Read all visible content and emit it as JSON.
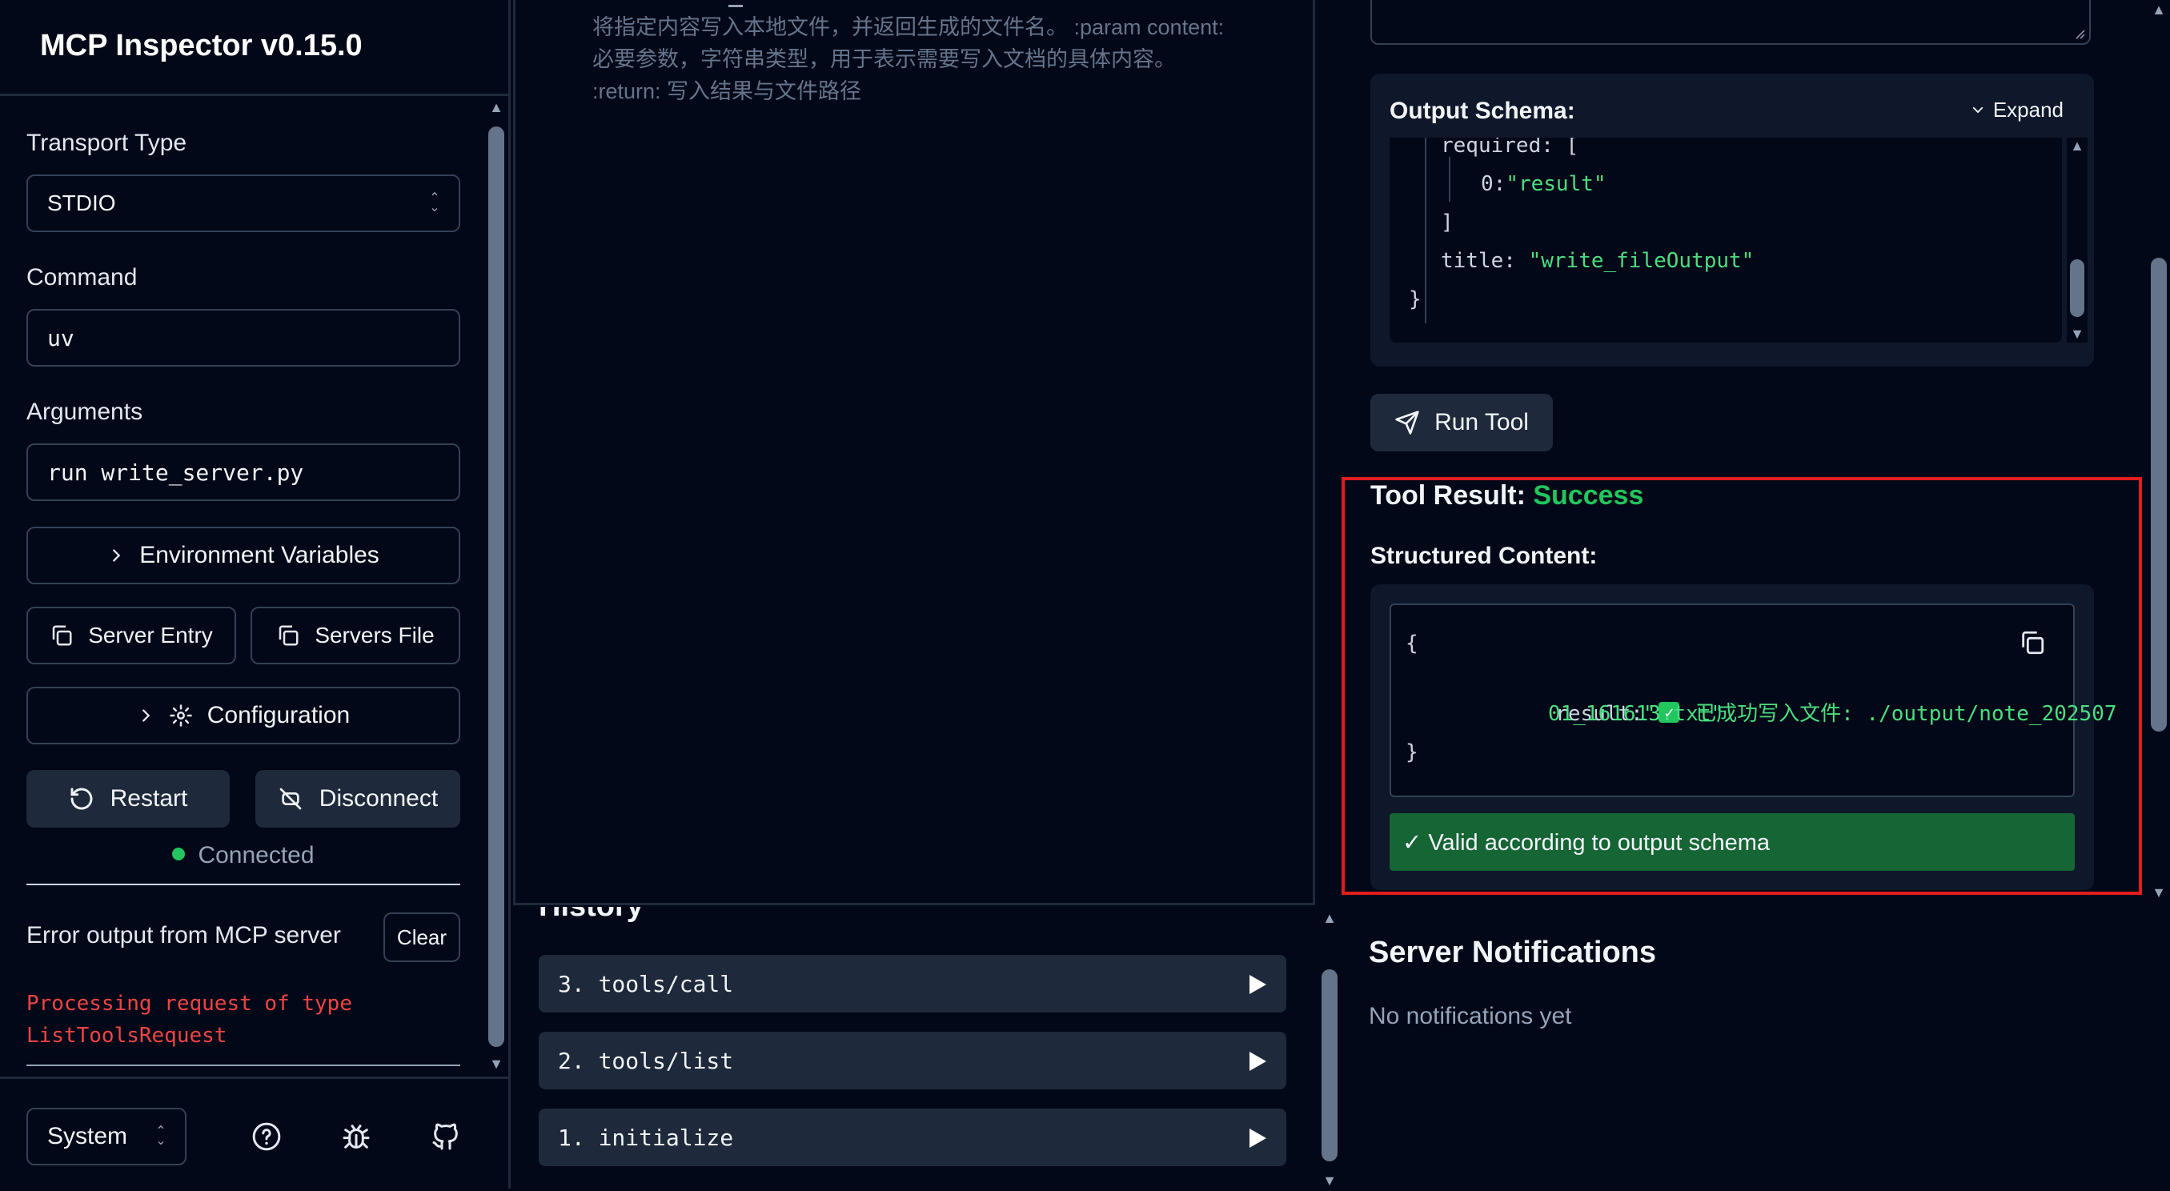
{
  "app": {
    "title": "MCP Inspector v0.15.0"
  },
  "sidebar": {
    "transport_label": "Transport Type",
    "transport_value": "STDIO",
    "command_label": "Command",
    "command_value": "uv",
    "arguments_label": "Arguments",
    "arguments_value": "run write_server.py",
    "env_vars_label": "Environment Variables",
    "server_entry_label": "Server Entry",
    "servers_file_label": "Servers File",
    "configuration_label": "Configuration",
    "restart_label": "Restart",
    "disconnect_label": "Disconnect",
    "status": "Connected",
    "status_color": "#22c55e",
    "error_title": "Error output from MCP server",
    "clear_label": "Clear",
    "error_lines": [
      "Processing request of type",
      "ListToolsRequest"
    ],
    "error_color": "#ef4444"
  },
  "footer": {
    "theme_value": "System",
    "icons": [
      "help-circle-icon",
      "bug-icon",
      "github-icon"
    ]
  },
  "tool": {
    "description_lines": [
      "将指定内容写入本地文件，并返回生成的文件名。 :param content:",
      "必要参数，字符串类型，用于表示需要写入文档的具体内容。",
      ":return: 写入结果与文件路径"
    ],
    "output_schema_title": "Output Schema:",
    "expand_label": "Expand",
    "schema_required_key": "required:",
    "schema_open_bracket": "[",
    "schema_index_key": "0:",
    "schema_index_value": "\"result\"",
    "schema_close_bracket": "]",
    "schema_title_key": "title:",
    "schema_title_value": "\"write_fileOutput\"",
    "schema_close_brace": "}",
    "run_label": "Run Tool"
  },
  "result": {
    "title": "Tool Result:",
    "status": "Success",
    "status_color": "#22c55e",
    "structured_title": "Structured Content:",
    "open_brace": "{",
    "key": "result:",
    "value_quote": "\"",
    "value_line1": "已成功写入文件: ./output/note_202507",
    "value_line2": "01_161613.txt\"",
    "close_brace": "}",
    "valid_text": "✓ Valid according to output schema",
    "highlight_color": "#e11d1d"
  },
  "history": {
    "title": "History",
    "items": [
      "3. tools/call",
      "2. tools/list",
      "1. initialize"
    ]
  },
  "notifications": {
    "title": "Server Notifications",
    "empty_text": "No notifications yet"
  }
}
